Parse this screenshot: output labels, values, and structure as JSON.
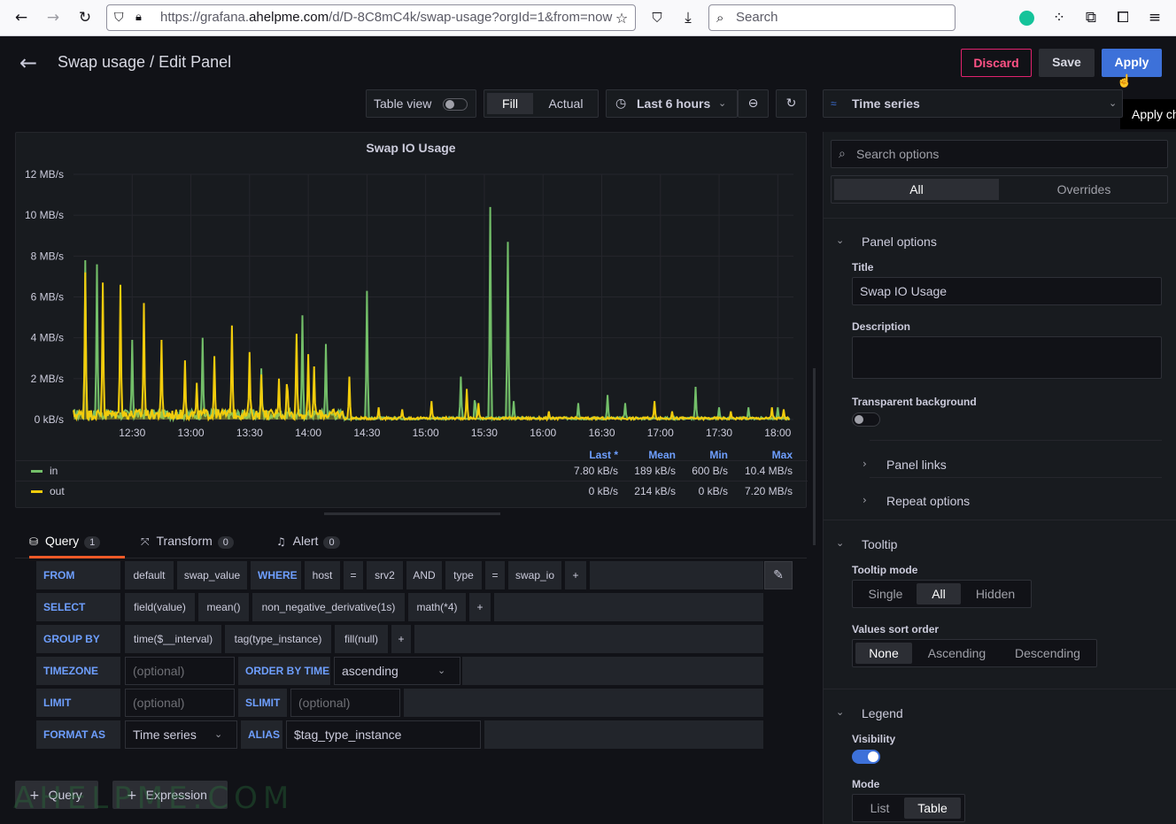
{
  "browser": {
    "url_host_pre": "https://grafana.",
    "url_host": "ahelpme.com",
    "url_rest": "/d/D-8C8mC4k/swap-usage?orgId=1&from=now",
    "search_placeholder": "Search"
  },
  "header": {
    "title": "Swap usage / Edit Panel",
    "discard": "Discard",
    "save": "Save",
    "apply": "Apply",
    "apply_tooltip": "Apply ch"
  },
  "toolbar": {
    "table_view": "Table view",
    "fill": "Fill",
    "actual": "Actual",
    "time_range": "Last 6 hours",
    "viz": "Time series"
  },
  "chart_data": {
    "type": "line",
    "title": "Swap IO Usage",
    "y_ticks": [
      "12 MB/s",
      "10 MB/s",
      "8 MB/s",
      "6 MB/s",
      "4 MB/s",
      "2 MB/s",
      "0 kB/s"
    ],
    "x_ticks": [
      "12:30",
      "13:00",
      "13:30",
      "14:00",
      "14:30",
      "15:00",
      "15:30",
      "16:00",
      "16:30",
      "17:00",
      "17:30",
      "18:00"
    ],
    "ylim": [
      0,
      12
    ],
    "y_unit": "MB/s",
    "grid": true,
    "series": [
      {
        "name": "in",
        "color": "#73bf69",
        "peaks": [
          [
            12.1,
            7.8
          ],
          [
            12.2,
            7.6
          ],
          [
            12.5,
            3.9
          ],
          [
            13.1,
            4.0
          ],
          [
            13.6,
            2.5
          ],
          [
            13.95,
            5.1
          ],
          [
            14.15,
            3.7
          ],
          [
            14.5,
            6.3
          ],
          [
            15.3,
            2.1
          ],
          [
            15.42,
            1.3
          ],
          [
            15.55,
            10.4
          ],
          [
            15.7,
            8.7
          ],
          [
            15.75,
            0.9
          ],
          [
            16.3,
            0.8
          ],
          [
            16.55,
            1.2
          ],
          [
            16.7,
            0.8
          ],
          [
            17.3,
            1.6
          ],
          [
            17.5,
            0.6
          ],
          [
            17.75,
            0.6
          ],
          [
            18.0,
            0.6
          ]
        ]
      },
      {
        "name": "out",
        "color": "#f2cc0c",
        "peaks": [
          [
            12.1,
            7.2
          ],
          [
            12.25,
            6.7
          ],
          [
            12.4,
            6.6
          ],
          [
            12.6,
            5.7
          ],
          [
            12.75,
            3.9
          ],
          [
            12.95,
            2.9
          ],
          [
            13.05,
            1.8
          ],
          [
            13.2,
            3.1
          ],
          [
            13.35,
            4.6
          ],
          [
            13.5,
            3.3
          ],
          [
            13.6,
            2.2
          ],
          [
            13.75,
            2.0
          ],
          [
            13.82,
            2.4
          ],
          [
            13.9,
            4.2
          ],
          [
            14.0,
            3.2
          ],
          [
            14.05,
            2.6
          ],
          [
            14.35,
            2.1
          ],
          [
            14.6,
            0.6
          ],
          [
            14.8,
            0.5
          ],
          [
            15.05,
            0.9
          ],
          [
            15.35,
            1.5
          ],
          [
            15.45,
            0.8
          ],
          [
            16.05,
            0.4
          ],
          [
            16.95,
            0.9
          ],
          [
            17.1,
            0.4
          ],
          [
            17.6,
            0.4
          ],
          [
            17.95,
            0.6
          ],
          [
            18.05,
            0.5
          ]
        ]
      }
    ],
    "legend": {
      "headers": [
        "Last *",
        "Mean",
        "Min",
        "Max"
      ],
      "rows": [
        {
          "name": "in",
          "color": "#73bf69",
          "last": "7.80 kB/s",
          "mean": "189 kB/s",
          "min": "600 B/s",
          "max": "10.4 MB/s"
        },
        {
          "name": "out",
          "color": "#f2cc0c",
          "last": "0 kB/s",
          "mean": "214 kB/s",
          "min": "0 kB/s",
          "max": "7.20 MB/s"
        }
      ]
    }
  },
  "query_tabs": [
    {
      "label": "Query",
      "count": "1"
    },
    {
      "label": "Transform",
      "count": "0"
    },
    {
      "label": "Alert",
      "count": "0"
    }
  ],
  "query": {
    "from": {
      "kw": "FROM",
      "parts": [
        "default",
        "swap_value"
      ],
      "where_kw": "WHERE",
      "cond": [
        "host",
        "=",
        "srv2",
        "AND",
        "type",
        "=",
        "swap_io"
      ],
      "plus": "+"
    },
    "select": {
      "kw": "SELECT",
      "parts": [
        "field(value)",
        "mean()",
        "non_negative_derivative(1s)",
        "math(*4)"
      ],
      "plus": "+"
    },
    "group_by": {
      "kw": "GROUP BY",
      "parts": [
        "time($__interval)",
        "tag(type_instance)",
        "fill(null)"
      ],
      "plus": "+"
    },
    "timezone": {
      "kw": "TIMEZONE",
      "placeholder": "(optional)",
      "order_kw": "ORDER BY TIME",
      "order_value": "ascending"
    },
    "limit": {
      "kw": "LIMIT",
      "placeholder": "(optional)",
      "slimit_kw": "SLIMIT",
      "slimit_placeholder": "(optional)"
    },
    "format": {
      "kw": "FORMAT AS",
      "value": "Time series",
      "alias_kw": "ALIAS",
      "alias_value": "$tag_type_instance"
    },
    "add_query": "Query",
    "add_expression": "Expression",
    "watermark": "AHELPME.COM"
  },
  "options": {
    "search_placeholder": "Search options",
    "tab_all": "All",
    "tab_overrides": "Overrides",
    "panel_options": "Panel options",
    "title_label": "Title",
    "title_value": "Swap IO Usage",
    "description_label": "Description",
    "transparent_label": "Transparent background",
    "panel_links": "Panel links",
    "repeat_options": "Repeat options",
    "tooltip": "Tooltip",
    "tooltip_mode_label": "Tooltip mode",
    "tooltip_modes": [
      "Single",
      "All",
      "Hidden"
    ],
    "sort_label": "Values sort order",
    "sort_modes": [
      "None",
      "Ascending",
      "Descending"
    ],
    "legend": "Legend",
    "visibility_label": "Visibility",
    "mode_label": "Mode",
    "modes": [
      "List",
      "Table"
    ]
  }
}
